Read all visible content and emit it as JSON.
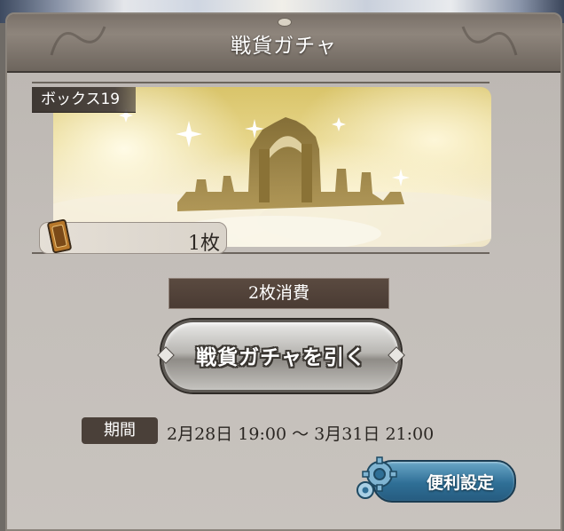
{
  "header": {
    "title": "戦貨ガチャ"
  },
  "box": {
    "label": "ボックス19",
    "ticket_count": "1枚",
    "ticket_icon": "ticket-card-icon"
  },
  "cost": {
    "label": "2枚消費"
  },
  "draw_button": {
    "label": "戦貨ガチャを引く"
  },
  "period": {
    "tag": "期間",
    "value": "2月28日 19:00 ～ 3月31日 21:00"
  },
  "settings_button": {
    "label": "便利設定",
    "icon": "gear-icon"
  },
  "colors": {
    "panel": "#c5c0bb",
    "header": "#7a7169",
    "cost_bar": "#4a3b33",
    "settings_blue": "#2f6f96",
    "period_tag": "#4a4039"
  }
}
